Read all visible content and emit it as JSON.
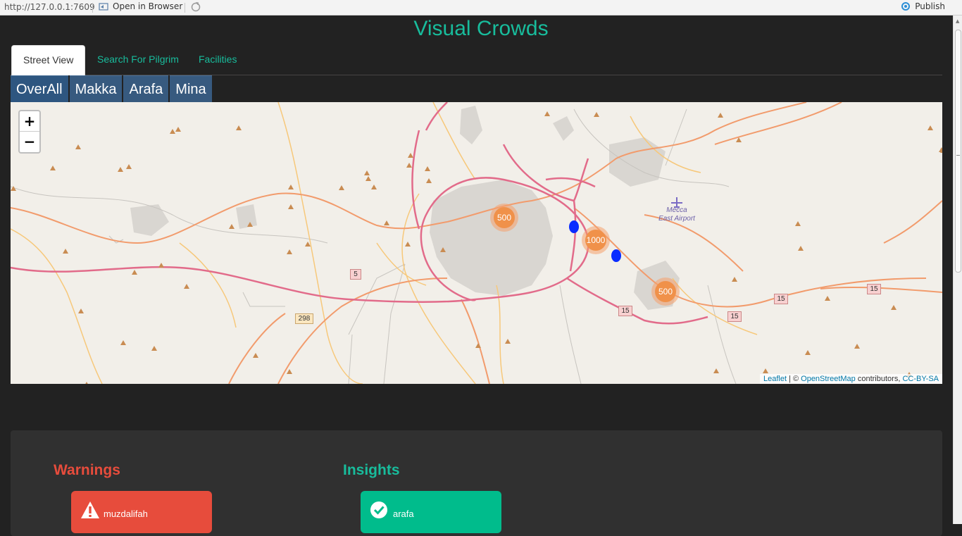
{
  "browser": {
    "url": "http://127.0.0.1:7609",
    "open_in_browser": "Open in Browser",
    "publish": "Publish"
  },
  "app": {
    "title": "Visual Crowds"
  },
  "tabs": [
    {
      "label": "Street View",
      "active": true
    },
    {
      "label": "Search For Pilgrim",
      "active": false
    },
    {
      "label": "Facilities",
      "active": false
    }
  ],
  "regions": [
    "OverAll",
    "Makka",
    "Arafa",
    "Mina"
  ],
  "map": {
    "zoom_in": "+",
    "zoom_out": "−",
    "clusters": [
      "500",
      "1000",
      "500"
    ],
    "road_labels": [
      "5",
      "298",
      "15",
      "15",
      "15",
      "15"
    ],
    "airport_label_line1": "Mecca",
    "airport_label_line2": "East Airport",
    "attribution": {
      "leaflet": "Leaflet",
      "sep": " | © ",
      "osm": "OpenStreetMap",
      "contributors": " contributors, ",
      "license": "CC-BY-SA"
    },
    "colors": {
      "cluster_fill": "#f0914a",
      "cluster_halo": "#f5a06c",
      "marker": "#0a2bff"
    }
  },
  "panel": {
    "warnings_heading": "Warnings",
    "insights_heading": "Insights",
    "warning_card": {
      "label": "muzdalifah",
      "icon": "warning-icon",
      "color": "#e74c3c"
    },
    "insight_card": {
      "label": "arafa",
      "icon": "check-circle-icon",
      "color": "#00bc8c"
    }
  }
}
